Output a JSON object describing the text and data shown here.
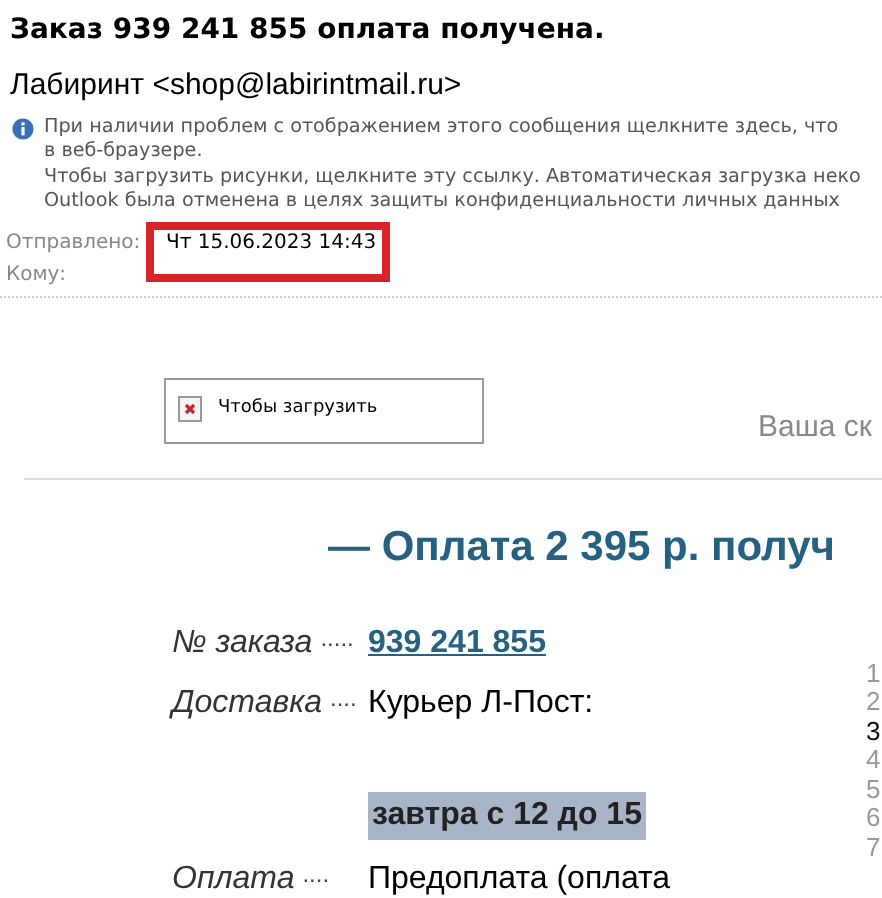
{
  "message": {
    "subject": "Заказ 939 241 855 оплата получена.",
    "sender": "Лабиринт <shop@labirintmail.ru>",
    "info_lines": [
      "При наличии проблем с отображением этого сообщения щелкните здесь, что",
      "в веб-браузере.",
      "Чтобы загрузить рисунки, щелкните эту ссылку. Автоматическая загрузка неко",
      "Outlook была отменена в целях защиты конфиденциальности личных данных"
    ],
    "sent_label": "Отправлено:",
    "sent_value": "Чт 15.06.2023 14:43",
    "sent_highlighted": true,
    "to_label": "Кому:"
  },
  "body": {
    "image_placeholder": "Чтобы загрузить",
    "side_text": "Ваша ск",
    "heading": "— Оплата 2 395 р. получ",
    "rows": [
      {
        "label": "№ заказа",
        "dots": ".....",
        "value": "939 241 855",
        "kind": "link"
      },
      {
        "label": "Доставка",
        "dots": "....",
        "value": "Курьер Л-Пост:",
        "kind": "text"
      },
      {
        "label": "",
        "dots": "",
        "value": "завтра с 12 до 15",
        "kind": "highlight"
      },
      {
        "label": "Оплата",
        "dots": "....",
        "value": "Предоплата (оплата",
        "kind": "text"
      }
    ],
    "steps": [
      {
        "label": "1",
        "current": false
      },
      {
        "label": "2",
        "current": false
      },
      {
        "label": "3",
        "current": true
      },
      {
        "label": "4",
        "current": false
      },
      {
        "label": "5",
        "current": false
      },
      {
        "label": "6",
        "current": false
      },
      {
        "label": "7",
        "current": false
      }
    ]
  }
}
